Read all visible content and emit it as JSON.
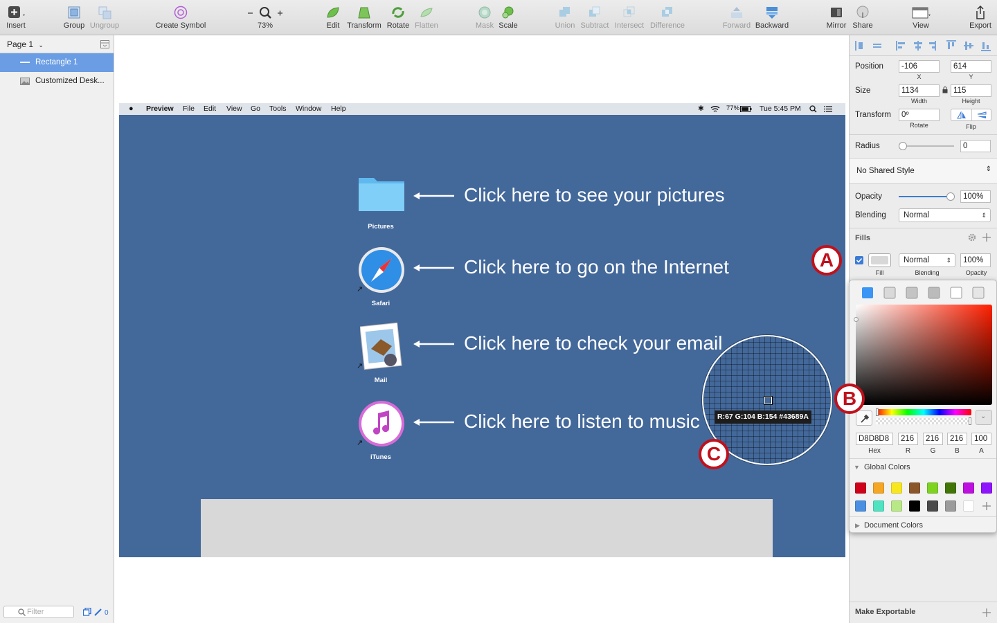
{
  "toolbar": {
    "insert": "Insert",
    "group": "Group",
    "ungroup": "Ungroup",
    "create_symbol": "Create Symbol",
    "zoom": "73%",
    "edit": "Edit",
    "transform": "Transform",
    "rotate": "Rotate",
    "flatten": "Flatten",
    "mask": "Mask",
    "scale": "Scale",
    "union": "Union",
    "subtract": "Subtract",
    "intersect": "Intersect",
    "difference": "Difference",
    "forward": "Forward",
    "backward": "Backward",
    "mirror": "Mirror",
    "share": "Share",
    "view": "View",
    "export": "Export"
  },
  "layers": {
    "page": "Page 1",
    "items": [
      "Rectangle 1",
      "Customized Desk..."
    ],
    "filter_placeholder": "Filter",
    "count": "0"
  },
  "desktop": {
    "menubar": {
      "app": "Preview",
      "menus": [
        "File",
        "Edit",
        "View",
        "Go",
        "Tools",
        "Window",
        "Help"
      ],
      "battery": "77%",
      "clock": "Tue 5:45 PM"
    },
    "rows": [
      {
        "label": "Pictures",
        "text": "Click here to see your pictures",
        "icon": "folder-icon"
      },
      {
        "label": "Safari",
        "text": "Click here to go on the Internet",
        "icon": "safari-icon"
      },
      {
        "label": "Mail",
        "text": "Click here to check your email",
        "icon": "mail-icon"
      },
      {
        "label": "iTunes",
        "text": "Click here to listen to music",
        "icon": "itunes-icon"
      }
    ]
  },
  "inspector": {
    "position_label": "Position",
    "x": "-106",
    "y": "614",
    "x_caption": "X",
    "y_caption": "Y",
    "size_label": "Size",
    "width": "1134",
    "height": "115",
    "width_caption": "Width",
    "height_caption": "Height",
    "transform_label": "Transform",
    "rotate": "0º",
    "rotate_caption": "Rotate",
    "flip_caption": "Flip",
    "radius_label": "Radius",
    "radius": "0",
    "shared_style": "No Shared Style",
    "opacity_label": "Opacity",
    "opacity": "100%",
    "opacity_level": 1.0,
    "blending_label": "Blending",
    "blending": "Normal",
    "fills_label": "Fills",
    "fill_blending": "Normal",
    "fill_opacity": "100%",
    "fill_caption": "Fill",
    "fill_blending_caption": "Blending",
    "fill_opacity_caption": "Opacity",
    "make_exportable": "Make Exportable"
  },
  "color_picker": {
    "hex": "D8D8D8",
    "r": "216",
    "g": "216",
    "b": "216",
    "a": "100",
    "hex_caption": "Hex",
    "r_caption": "R",
    "g_caption": "G",
    "b_caption": "B",
    "a_caption": "A",
    "global_colors_label": "Global Colors",
    "document_colors_label": "Document Colors",
    "global_colors": [
      "#d0021b",
      "#f5a623",
      "#f8e71c",
      "#8b572a",
      "#7ed321",
      "#417505",
      "#bd10e0",
      "#9013fe",
      "#4a90e2",
      "#50e3c2",
      "#b8e986",
      "#000000",
      "#4a4a4a",
      "#9b9b9b",
      "#ffffff"
    ]
  },
  "magnifier": {
    "readout": "R:67 G:104 B:154 #43689A"
  },
  "callouts": {
    "a": "A",
    "b": "B",
    "c": "C"
  },
  "colors": {
    "desktop_bg": "#43689a",
    "selection": "#6a9de4",
    "callout_red": "#c0111c",
    "rectangle_fill": "#d8d8d8"
  }
}
